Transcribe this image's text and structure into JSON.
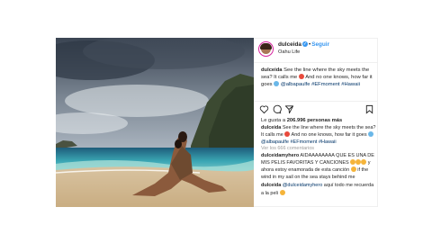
{
  "post": {
    "username": "dulceida",
    "verified_mark": "✓",
    "follow_separator": "•",
    "follow_label": "Seguir",
    "location": "Oahu Life"
  },
  "caption": {
    "author": "dulceida",
    "text_a": "See the line where the sky meets the sea? It calls me",
    "text_b": "And no one knows, how far it goes",
    "mention": "@albapaulfe",
    "hashtags": "#EFmoment #Hawaii"
  },
  "likes": {
    "prefix": "Le gusta a",
    "count": "206.996 personas más"
  },
  "first_comment": {
    "author": "dulceida",
    "text_a": "See the line where the sky meets the sea? It calls me",
    "text_b": "And no one knows, how far it goes",
    "mention": "@albapaulfe",
    "hashtags": "#EFmoment #Hawaii"
  },
  "view_more": "Ver los 666 comentarios",
  "comments": [
    {
      "author": "dulceidamyhero",
      "text_a": "AIDAAAAAAAA QUE ES UNA DE MIS PELIS FAVORITAS Y CANCIONES",
      "text_b": "y ahora estoy enamorada de esta canción",
      "text_c": "if the wind in my sail on the sea stays behind me"
    },
    {
      "author": "dulceida",
      "mention": "@dulceidamyhero",
      "text_a": "aquí todo me recuerda a la peli"
    }
  ],
  "colors": {
    "link": "#003569",
    "follow": "#3897f0",
    "muted": "#999999"
  },
  "icons": [
    "heart-icon",
    "comment-icon",
    "share-icon",
    "bookmark-icon"
  ]
}
